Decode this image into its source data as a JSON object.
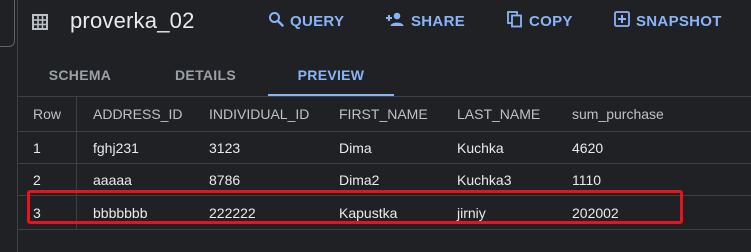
{
  "header": {
    "title": "proverka_02",
    "actions": {
      "query": "QUERY",
      "share": "SHARE",
      "copy": "COPY",
      "snapshot": "SNAPSHOT"
    },
    "accent_color": "#8ab4f8"
  },
  "tabs": {
    "schema": "SCHEMA",
    "details": "DETAILS",
    "preview": "PREVIEW",
    "active": "PREVIEW"
  },
  "table": {
    "columns": [
      "Row",
      "ADDRESS_ID",
      "INDIVIDUAL_ID",
      "FIRST_NAME",
      "LAST_NAME",
      "sum_purchase"
    ],
    "rows": [
      [
        "1",
        "fghj231",
        "3123",
        "Dima",
        "Kuchka",
        "4620"
      ],
      [
        "2",
        "aaaaa",
        "8786",
        "Dima2",
        "Kuchka3",
        "1110"
      ],
      [
        "3",
        "bbbbbbb",
        "222222",
        "Kapustka",
        "jirniy",
        "202002"
      ]
    ],
    "highlighted_row": "3",
    "highlight_color": "#e8141b"
  },
  "icons": {
    "table": "table-icon",
    "query": "search-icon",
    "share": "person-add-icon",
    "copy": "copy-icon",
    "snapshot": "snapshot-icon"
  }
}
